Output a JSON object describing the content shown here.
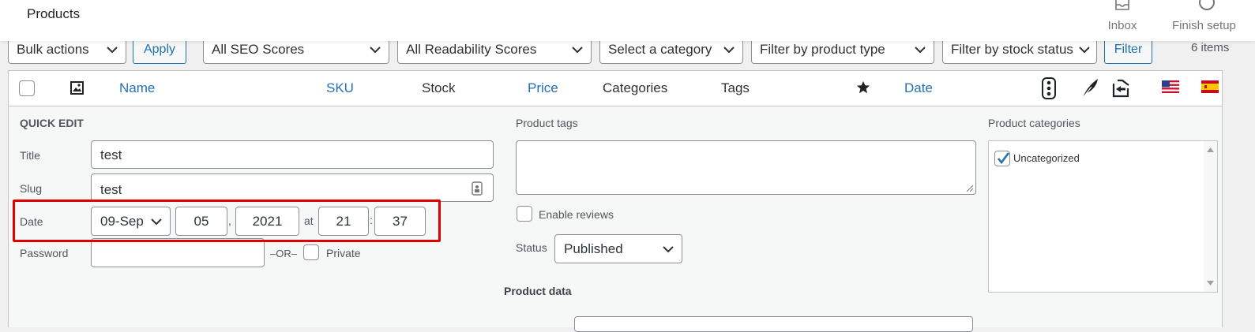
{
  "header": {
    "title": "Products",
    "inbox_label": "Inbox",
    "finish_setup_label": "Finish setup"
  },
  "filters": {
    "bulk_actions": "Bulk actions",
    "apply_label": "Apply",
    "seo_scores": "All SEO Scores",
    "readability_scores": "All Readability Scores",
    "category": "Select a category",
    "product_type": "Filter by product type",
    "stock_status": "Filter by stock status",
    "filter_label": "Filter",
    "items_count": "6 items"
  },
  "table": {
    "columns": {
      "name": "Name",
      "sku": "SKU",
      "stock": "Stock",
      "price": "Price",
      "categories": "Categories",
      "tags": "Tags",
      "date": "Date"
    },
    "icons": [
      "image-icon",
      "star-icon",
      "seo-traffic-light-icon",
      "readability-feather-icon",
      "links-icon",
      "flag-us-icon",
      "flag-es-icon"
    ]
  },
  "quick_edit": {
    "heading": "QUICK EDIT",
    "title_label": "Title",
    "title_value": "test",
    "slug_label": "Slug",
    "slug_value": "test",
    "date_label": "Date",
    "date_month": "09-Sep",
    "date_day": "05",
    "date_comma": ",",
    "date_year": "2021",
    "date_at": "at",
    "date_hour": "21",
    "date_colon": ":",
    "date_minute": "37",
    "password_label": "Password",
    "password_value": "",
    "or_label": "–OR–",
    "private_label": "Private",
    "tags_label": "Product tags",
    "tags_value": "",
    "enable_reviews_label": "Enable reviews",
    "status_label": "Status",
    "status_value": "Published",
    "product_data_label": "Product data",
    "categories_label": "Product categories",
    "categories": [
      {
        "label": "Uncategorized",
        "checked": true
      }
    ]
  },
  "colors": {
    "link": "#2271b1",
    "highlight": "#e00000",
    "panel_bg": "#f6f7f7"
  }
}
